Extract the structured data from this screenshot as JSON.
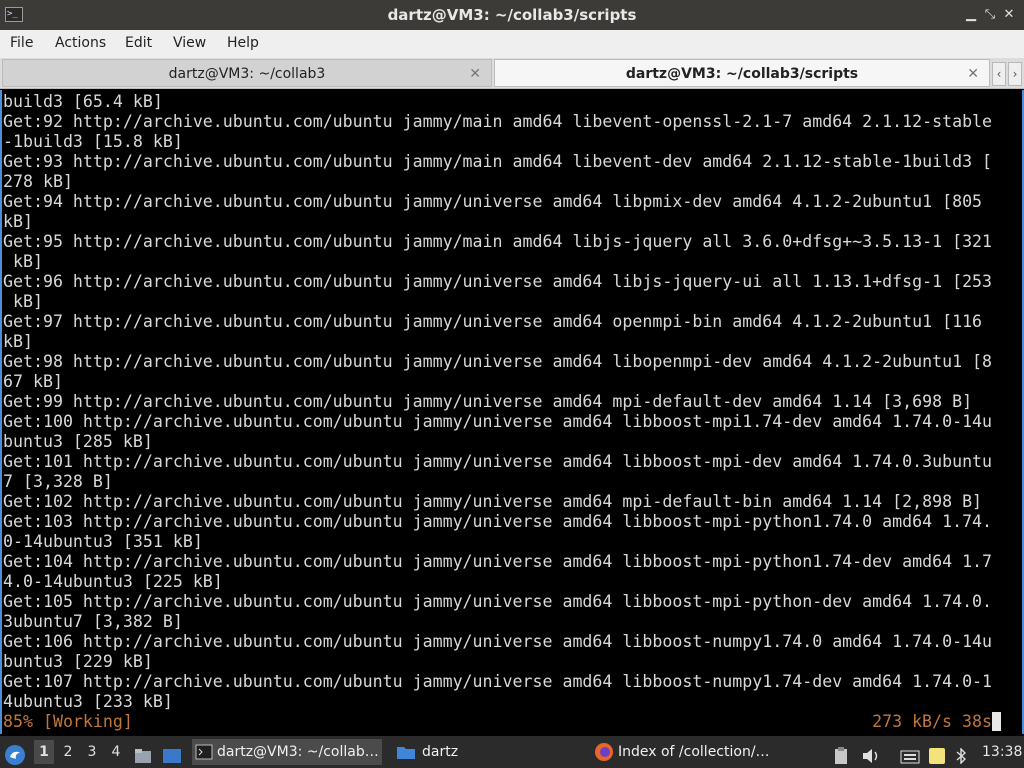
{
  "window": {
    "title": "dartz@VM3: ~/collab3/scripts",
    "app_icon": "terminal-icon",
    "controls": [
      "minimize-icon",
      "restore-icon",
      "close-icon"
    ]
  },
  "menu": [
    "File",
    "Actions",
    "Edit",
    "View",
    "Help"
  ],
  "tabs": [
    {
      "label": "dartz@VM3: ~/collab3",
      "active": false
    },
    {
      "label": "dartz@VM3: ~/collab3/scripts",
      "active": true
    }
  ],
  "tab_close_glyph": "✕",
  "tab_scroll": {
    "left": "‹",
    "right": "›"
  },
  "terminal": {
    "lines": [
      "build3 [65.4 kB]",
      "Get:92 http://archive.ubuntu.com/ubuntu jammy/main amd64 libevent-openssl-2.1-7 amd64 2.1.12-stable",
      "-1build3 [15.8 kB]",
      "Get:93 http://archive.ubuntu.com/ubuntu jammy/main amd64 libevent-dev amd64 2.1.12-stable-1build3 [",
      "278 kB]",
      "Get:94 http://archive.ubuntu.com/ubuntu jammy/universe amd64 libpmix-dev amd64 4.1.2-2ubuntu1 [805",
      "kB]",
      "Get:95 http://archive.ubuntu.com/ubuntu jammy/main amd64 libjs-jquery all 3.6.0+dfsg+~3.5.13-1 [321",
      " kB]",
      "Get:96 http://archive.ubuntu.com/ubuntu jammy/universe amd64 libjs-jquery-ui all 1.13.1+dfsg-1 [253",
      " kB]",
      "Get:97 http://archive.ubuntu.com/ubuntu jammy/universe amd64 openmpi-bin amd64 4.1.2-2ubuntu1 [116",
      "kB]",
      "Get:98 http://archive.ubuntu.com/ubuntu jammy/universe amd64 libopenmpi-dev amd64 4.1.2-2ubuntu1 [8",
      "67 kB]",
      "Get:99 http://archive.ubuntu.com/ubuntu jammy/universe amd64 mpi-default-dev amd64 1.14 [3,698 B]",
      "Get:100 http://archive.ubuntu.com/ubuntu jammy/universe amd64 libboost-mpi1.74-dev amd64 1.74.0-14u",
      "buntu3 [285 kB]",
      "Get:101 http://archive.ubuntu.com/ubuntu jammy/universe amd64 libboost-mpi-dev amd64 1.74.0.3ubuntu",
      "7 [3,328 B]",
      "Get:102 http://archive.ubuntu.com/ubuntu jammy/universe amd64 mpi-default-bin amd64 1.14 [2,898 B]",
      "Get:103 http://archive.ubuntu.com/ubuntu jammy/universe amd64 libboost-mpi-python1.74.0 amd64 1.74.",
      "0-14ubuntu3 [351 kB]",
      "Get:104 http://archive.ubuntu.com/ubuntu jammy/universe amd64 libboost-mpi-python1.74-dev amd64 1.7",
      "4.0-14ubuntu3 [225 kB]",
      "Get:105 http://archive.ubuntu.com/ubuntu jammy/universe amd64 libboost-mpi-python-dev amd64 1.74.0.",
      "3ubuntu7 [3,382 B]",
      "Get:106 http://archive.ubuntu.com/ubuntu jammy/universe amd64 libboost-numpy1.74.0 amd64 1.74.0-14u",
      "buntu3 [229 kB]",
      "Get:107 http://archive.ubuntu.com/ubuntu jammy/universe amd64 libboost-numpy1.74-dev amd64 1.74.0-1",
      "4ubuntu3 [233 kB]"
    ],
    "status_left": "85% [Working]",
    "status_right": "273 kB/s 38s",
    "status_color": "#c2773a",
    "accent_color": "#4a8fd9"
  },
  "taskbar": {
    "start_icon": "start-menu-icon",
    "workspaces": [
      "1",
      "2",
      "3",
      "4"
    ],
    "active_workspace": "1",
    "tasks": [
      {
        "label": "dartz@VM3: ~/collab…",
        "icon": "terminal-icon",
        "active": true
      },
      {
        "label": "dartz",
        "icon": "folder-icon",
        "active": false
      },
      {
        "label": "Index of /collection/…",
        "icon": "firefox-icon",
        "active": false
      }
    ],
    "tray_icons": [
      "clipboard-icon",
      "volume-icon",
      "keyboard-icon",
      "notes-icon",
      "bluetooth-icon"
    ],
    "clock": "13:38"
  }
}
